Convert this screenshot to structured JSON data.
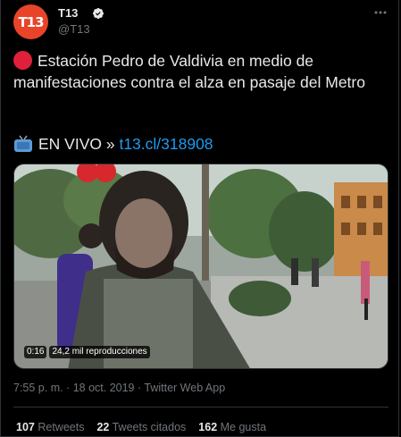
{
  "account": {
    "avatar_text": "T13",
    "display_name": "T13",
    "handle": "@T13",
    "verified": true
  },
  "tweet": {
    "text": "Estación Pedro de Valdivia en medio de manifestaciones contra el alza en pasaje del Metro",
    "live_prefix": "EN VIVO » ",
    "link_text": "t13.cl/318908",
    "timestamp": "7:55 p. m. · 18 oct. 2019 · Twitter Web App"
  },
  "video": {
    "duration": "0:16",
    "views": "24,2 mil reproducciones"
  },
  "stats": {
    "retweets_count": "107",
    "retweets_label": "Retweets",
    "quotes_count": "22",
    "quotes_label": "Tweets citados",
    "likes_count": "162",
    "likes_label": "Me gusta"
  },
  "colors": {
    "background": "#000000",
    "brand": "#e8442a",
    "link": "#1d9bf0",
    "secondary_text": "#71767b",
    "red_circle": "#e0203a"
  },
  "icons": {
    "verified": "verified-badge-icon",
    "more": "more-options-icon",
    "record": "red-circle-icon",
    "tv": "television-icon"
  }
}
